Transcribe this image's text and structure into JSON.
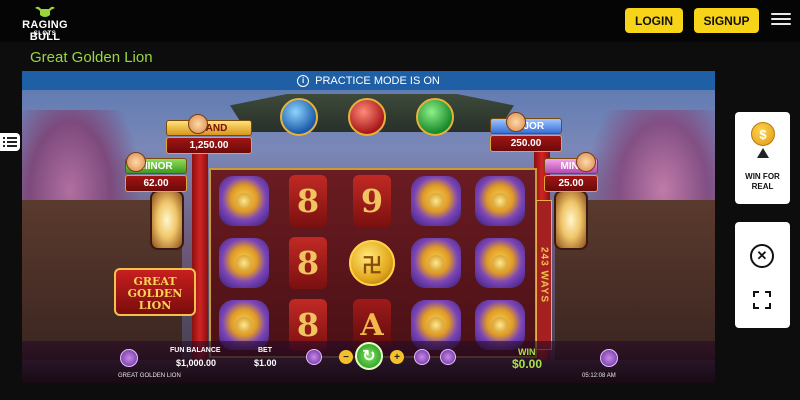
{
  "header": {
    "logo_text": "RAGING BULL",
    "logo_sub": "SLOTS",
    "login_label": "LOGIN",
    "signup_label": "SIGNUP"
  },
  "game_title": "Great Golden Lion",
  "practice_banner": "PRACTICE MODE IS ON",
  "jackpots": {
    "grand": {
      "label": "GRAND",
      "value": "1,250.00"
    },
    "major": {
      "label": "MAJOR",
      "value": "250.00"
    },
    "minor": {
      "label": "MINOR",
      "value": "62.00"
    },
    "mini": {
      "label": "MINI",
      "value": "25.00"
    }
  },
  "game_logo": "GREAT GOLDEN LION",
  "ways_text": "243 WAYS",
  "reels": {
    "rows": [
      [
        "lion",
        "8",
        "9",
        "lion",
        "lion"
      ],
      [
        "lion",
        "8",
        "coin",
        "lion",
        "lion"
      ],
      [
        "lion",
        "8",
        "A",
        "lion",
        "lion"
      ]
    ],
    "symbol_text": {
      "8": "8",
      "9": "9",
      "A": "A",
      "coin": "卍"
    }
  },
  "controls": {
    "balance_label": "FUN BALANCE",
    "balance_value": "$1,000.00",
    "bet_label": "BET",
    "bet_value": "$1.00",
    "win_label": "WIN",
    "win_value": "$0.00",
    "minus": "−",
    "plus": "+",
    "spin": "↻"
  },
  "footer": {
    "game_name": "GREAT GOLDEN LION",
    "time": "05:12:08 AM"
  },
  "side": {
    "win_for_real_line1": "WIN FOR",
    "win_for_real_line2": "REAL",
    "coin_glyph": "$",
    "close_glyph": "✕"
  },
  "colors": {
    "accent_yellow": "#f7d417",
    "title_green": "#9ad642",
    "practice_blue": "#1f5fa6",
    "win_green": "#a8e24a"
  },
  "icons": {
    "hamburger": "hamburger-menu-icon",
    "info": "info-icon",
    "coin": "coin-icon",
    "up_arrow": "arrow-up-icon",
    "close": "close-icon",
    "fullscreen": "expand-icon"
  }
}
